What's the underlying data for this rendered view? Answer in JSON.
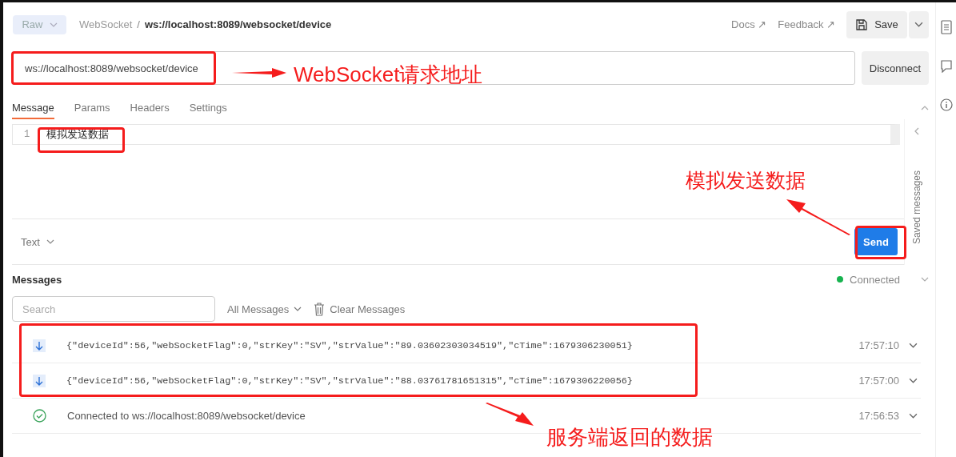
{
  "request": {
    "mode": "Raw",
    "breadcrumb": [
      "WebSocket",
      "ws://localhost:8089/websocket/device"
    ],
    "separator": "/",
    "links": [
      "Docs ↗",
      "Feedback ↗"
    ],
    "save": "Save",
    "url": "ws://localhost:8089/websocket/device",
    "action": "Disconnect"
  },
  "tabs": [
    {
      "label": "Message",
      "selected": true
    },
    {
      "label": "Params",
      "selected": false
    },
    {
      "label": "Headers",
      "selected": false
    },
    {
      "label": "Settings",
      "selected": false
    }
  ],
  "editor": {
    "lines": [
      {
        "number": "1",
        "text": "模拟发送数据"
      }
    ],
    "format": "Text",
    "send": "Send",
    "side_panel": "Saved messages"
  },
  "messages": {
    "title": "Messages",
    "status": "Connected",
    "search": {
      "placeholder": "Search"
    },
    "filter": "All Messages",
    "clear": "Clear Messages",
    "items": [
      {
        "kind": "incoming",
        "text": "{\"deviceId\":56,\"webSocketFlag\":0,\"strKey\":\"SV\",\"strValue\":\"89.03602303034519\",\"cTime\":1679306230051}",
        "time": "17:57:10"
      },
      {
        "kind": "incoming",
        "text": "{\"deviceId\":56,\"webSocketFlag\":0,\"strKey\":\"SV\",\"strValue\":\"88.03761781651315\",\"cTime\":1679306220056}",
        "time": "17:57:00"
      },
      {
        "kind": "connected",
        "text": "Connected to ws://localhost:8089/websocket/device",
        "time": "17:56:53"
      }
    ]
  },
  "annotations": [
    "WebSocket请求地址",
    "模拟发送数据",
    "服务端返回的数据"
  ]
}
